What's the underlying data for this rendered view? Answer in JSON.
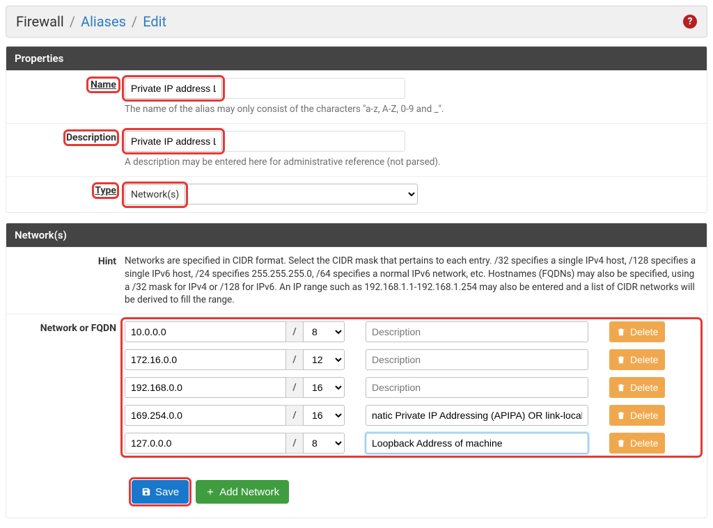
{
  "breadcrumb": {
    "root": "Firewall",
    "link1": "Aliases",
    "link2": "Edit"
  },
  "panels": {
    "properties": "Properties",
    "networks": "Network(s)"
  },
  "labels": {
    "name": "Name",
    "description": "Description",
    "type": "Type",
    "hint": "Hint",
    "network_or_fqdn": "Network or FQDN"
  },
  "fields": {
    "name_value": "Private IP address List",
    "name_help": "The name of the alias may only consist of the characters \"a-z, A-Z, 0-9 and _\".",
    "description_value": "Private IP address List",
    "description_help": "A description may be entered here for administrative reference (not parsed).",
    "type_value": "Network(s)"
  },
  "hint_text": "Networks are specified in CIDR format. Select the CIDR mask that pertains to each entry. /32 specifies a single IPv4 host, /128 specifies a single IPv6 host, /24 specifies 255.255.255.0, /64 specifies a normal IPv6 network, etc. Hostnames (FQDNs) may also be specified, using a /32 mask for IPv4 or /128 for IPv6. An IP range such as 192.168.1.1-192.168.1.254 may also be entered and a list of CIDR networks will be derived to fill the range.",
  "desc_placeholder": "Description",
  "networks": [
    {
      "addr": "10.0.0.0",
      "cidr": "8",
      "desc": ""
    },
    {
      "addr": "172.16.0.0",
      "cidr": "12",
      "desc": ""
    },
    {
      "addr": "192.168.0.0",
      "cidr": "16",
      "desc": ""
    },
    {
      "addr": "169.254.0.0",
      "cidr": "16",
      "desc": "natic Private IP Addressing (APIPA) OR link-local addres"
    },
    {
      "addr": "127.0.0.0",
      "cidr": "8",
      "desc": "Loopback Address of machine"
    }
  ],
  "buttons": {
    "delete": "Delete",
    "save": "Save",
    "add_network": "Add Network"
  }
}
